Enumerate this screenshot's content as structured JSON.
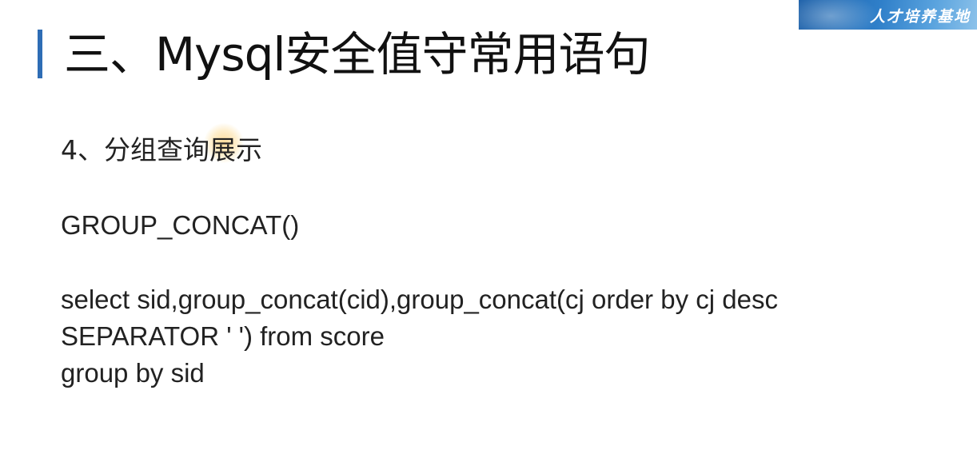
{
  "banner": {
    "text": "人才培养基地",
    "colors": [
      "#1b5fa8",
      "#5aa3de"
    ]
  },
  "slide": {
    "title": "三、Mysql安全值守常用语句",
    "subtitle": "4、分组查询展示",
    "function_name": "GROUP_CONCAT()",
    "sql_lines": [
      "select sid,group_concat(cid),group_concat(cj order by cj desc",
      "SEPARATOR ' ') from score",
      "group by sid"
    ],
    "accent_color": "#2e6db5"
  }
}
